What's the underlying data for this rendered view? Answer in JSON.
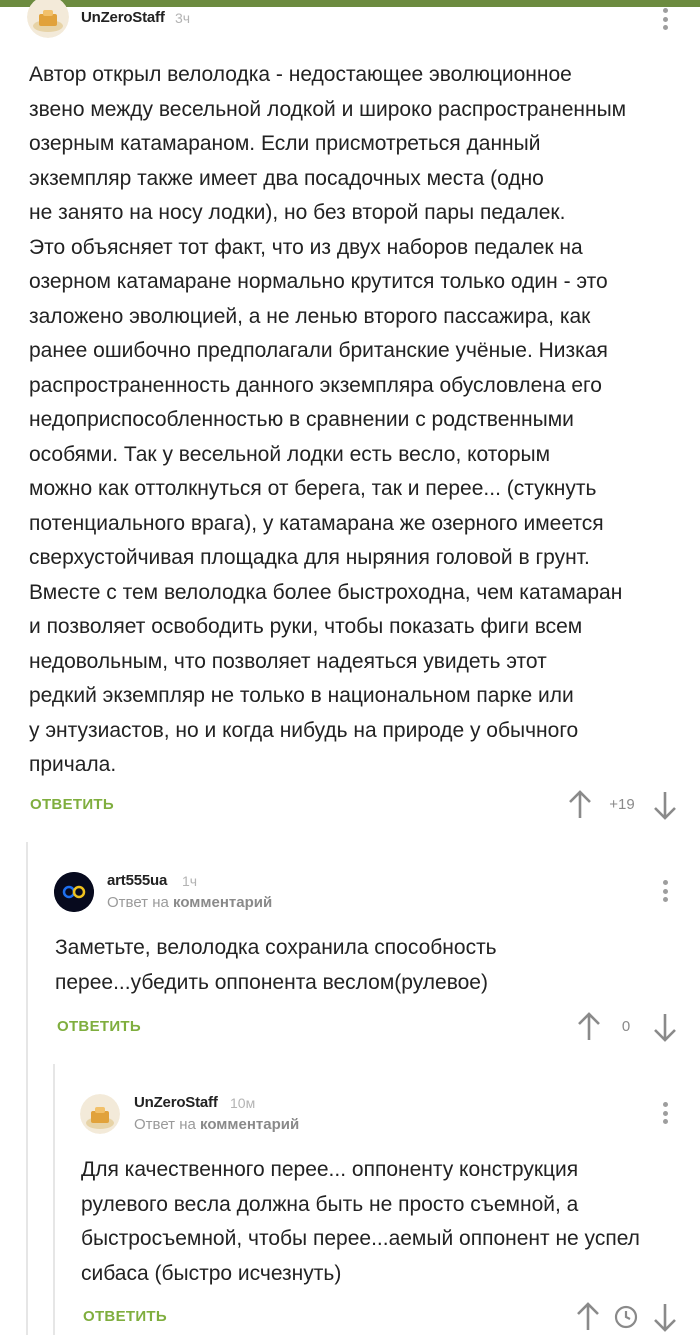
{
  "comments": [
    {
      "username": "UnZeroStaff",
      "time": "3ч",
      "reply_prefix": "",
      "reply_target": "",
      "lines": [
        "Автор открыл велолодка - недостающее эволюционное",
        "звено между весельной лодкой и широко распространенным",
        "озерным катамараном. Если присмотреться данный",
        "экземпляр также имеет два посадочных места (одно",
        "не занято на носу лодки), но без второй пары педалек.",
        "Это объясняет тот факт, что из двух наборов педалек на",
        "озерном катамаране нормально крутится только один - это",
        "заложено эволюцией, а не ленью второго пассажира, как",
        "ранее ошибочно предполагали британские учёные. Низкая",
        "распространенность данного экземпляра обусловлена его",
        "недоприспособленностью в сравнении с родственными",
        "особями. Так у весельной лодки есть весло, которым",
        "можно как оттолкнуться от берега, так и перее... (стукнуть",
        "потенциального врага), у катамарана же озерного имеется",
        "сверхустойчивая площадка для ныряния головой в грунт.",
        "Вместе с тем велолодка более быстроходна, чем катамаран",
        "и позволяет освободить руки, чтобы показать фиги всем",
        "недовольным, что позволяет надеяться увидеть этот",
        "редкий экземпляр не только в национальном парке или",
        "у энтузиастов, но и когда нибудь на природе у обычного",
        "причала."
      ],
      "reply_label": "ОТВЕТИТЬ",
      "rating": "+19"
    },
    {
      "username": "art555ua",
      "time": "1ч",
      "reply_prefix": "Ответ на",
      "reply_target": "комментарий",
      "lines": [
        "Заметьте, велолодка сохранила способность",
        "перее...убедить оппонента веслом(рулевое)"
      ],
      "reply_label": "ОТВЕТИТЬ",
      "rating": "0"
    },
    {
      "username": "UnZeroStaff",
      "time": "10м",
      "reply_prefix": "Ответ на",
      "reply_target": "комментарий",
      "lines": [
        "Для качественного перее... оппоненту конструкция",
        "рулевого весла должна быть не просто съемной, а",
        "быстросъемной, чтобы перее...аемый оппонент не успел",
        "сибаса (быстро исчезнуть)"
      ],
      "reply_label": "ОТВЕТИТЬ",
      "rating": ""
    }
  ],
  "icons": {
    "upvote": "arrow-up-icon",
    "downvote": "arrow-down-icon",
    "more": "more-vertical-icon",
    "clock": "clock-icon"
  },
  "colors": {
    "accent": "#7fae3e",
    "topbar": "#6c8b3f",
    "muted": "#9a9a9a"
  }
}
